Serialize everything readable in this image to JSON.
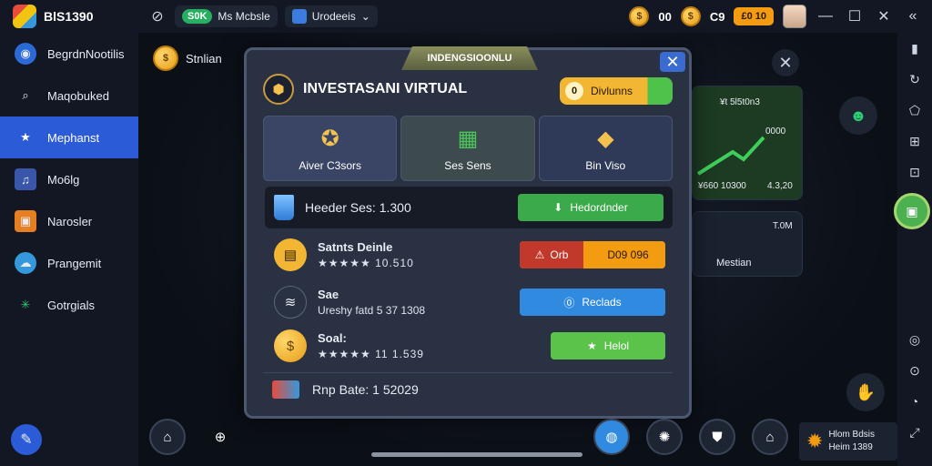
{
  "topbar": {
    "app_title": "BlS1390",
    "pill1_badge": "S0K",
    "pill1_text": "Ms Mcbsle",
    "pill2_text": "Urodeeis",
    "counter1": "00",
    "counter2": "C9",
    "gold_pill": "£0 10"
  },
  "sidebar": {
    "items": [
      {
        "label": "BegrdnNootilis",
        "icon": "globe-icon"
      },
      {
        "label": "Maqobuked",
        "icon": "search-icon"
      },
      {
        "label": "Mephanst",
        "icon": "star-icon"
      },
      {
        "label": "Mo6lg",
        "icon": "music-icon"
      },
      {
        "label": "Narosler",
        "icon": "briefcase-icon"
      },
      {
        "label": "Prangemit",
        "icon": "cloud-icon"
      },
      {
        "label": "Gotrgials",
        "icon": "shuffle-icon"
      }
    ]
  },
  "game": {
    "coin_label": "Stnlian",
    "bg_card1_a": "¥t 5l5t0n3",
    "bg_card1_b": "0000",
    "bg_card1_c": "¥660 10300",
    "bg_card1_d": "4.3,20",
    "bg_card2_a": "T.0M",
    "bg_card2_b": "Mestian"
  },
  "modal": {
    "banner": "INDENGSIOONLU",
    "title": "INVESTASANI VIRTUAL",
    "div_button": "Divlunns",
    "categories": [
      {
        "label": "Aiver C3sors",
        "icon": "compass-icon"
      },
      {
        "label": "Ses Sens",
        "icon": "box-icon"
      },
      {
        "label": "Bin Viso",
        "icon": "package-icon"
      }
    ],
    "header_row": {
      "text": "Heeder Ses: 1.300",
      "button": "Hedordnder"
    },
    "rows": [
      {
        "name": "Satnts Deinle",
        "sub": "★★★★★ 10.510",
        "button_warn": "Orb",
        "button_val": "D09 096"
      },
      {
        "name": "Sae",
        "sub": "Ureshy fatd 5 37 1308",
        "button": "Reclads"
      },
      {
        "name": "Soal:",
        "sub": "★★★★★ 11 1.539",
        "button": "Helol"
      }
    ],
    "footer": "Rnp Bate: 1 52029"
  },
  "notif": {
    "line1": "Hlom Bdsis",
    "line2": "Heim 1389"
  }
}
